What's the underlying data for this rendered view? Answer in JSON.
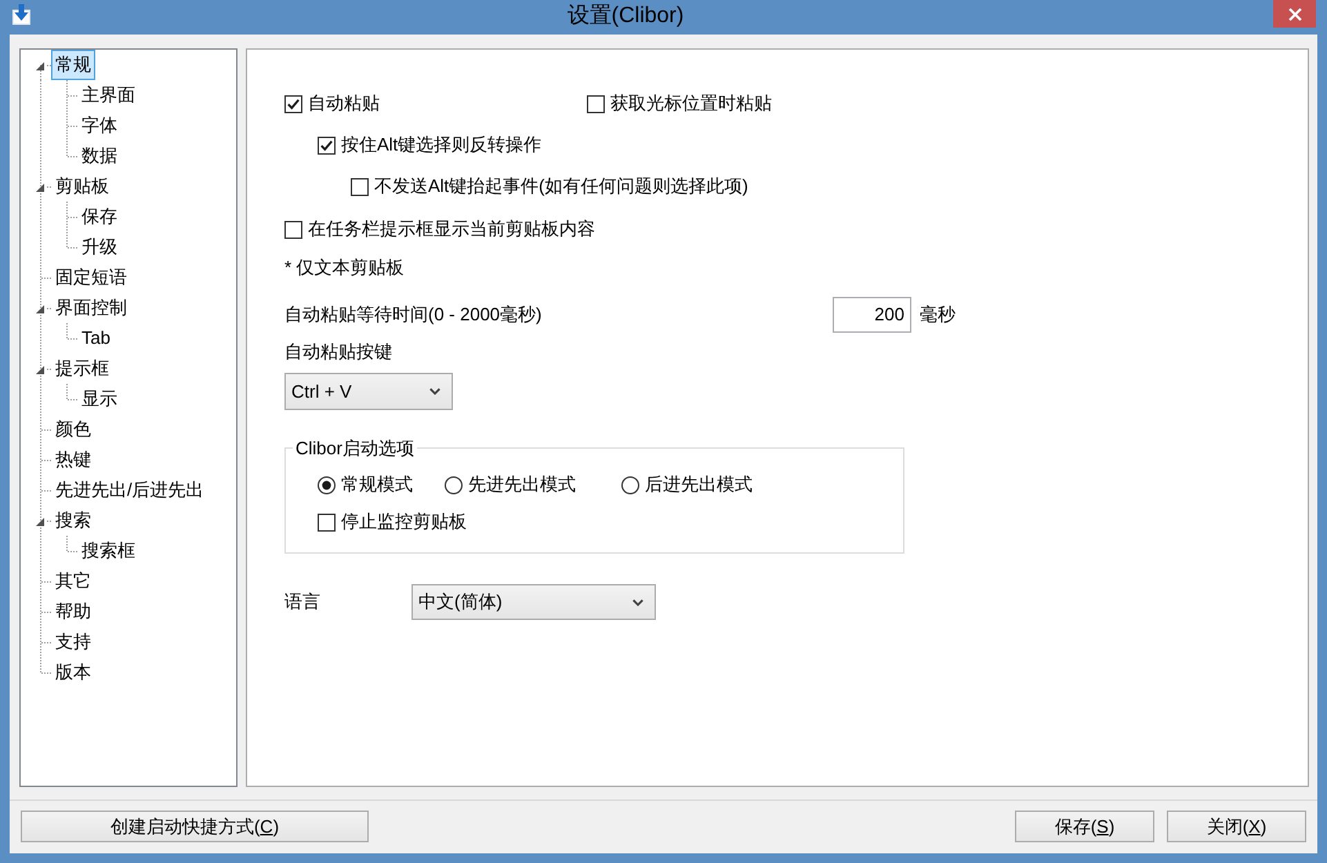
{
  "window": {
    "title": "设置(Clibor)"
  },
  "tree": [
    {
      "label": "常规",
      "selected": true,
      "expanded": true,
      "children": [
        {
          "label": "主界面",
          "selected": false
        },
        {
          "label": "字体",
          "selected": false
        },
        {
          "label": "数据",
          "selected": false
        }
      ]
    },
    {
      "label": "剪贴板",
      "selected": false,
      "expanded": true,
      "children": [
        {
          "label": "保存",
          "selected": false
        },
        {
          "label": "升级",
          "selected": false
        }
      ]
    },
    {
      "label": "固定短语",
      "selected": false
    },
    {
      "label": "界面控制",
      "selected": false,
      "expanded": true,
      "children": [
        {
          "label": "Tab",
          "selected": false
        }
      ]
    },
    {
      "label": "提示框",
      "selected": false,
      "expanded": true,
      "children": [
        {
          "label": "显示",
          "selected": false
        }
      ]
    },
    {
      "label": "颜色",
      "selected": false
    },
    {
      "label": "热键",
      "selected": false
    },
    {
      "label": "先进先出/后进先出",
      "selected": false
    },
    {
      "label": "搜索",
      "selected": false,
      "expanded": true,
      "children": [
        {
          "label": "搜索框",
          "selected": false
        }
      ]
    },
    {
      "label": "其它",
      "selected": false
    },
    {
      "label": "帮助",
      "selected": false
    },
    {
      "label": "支持",
      "selected": false
    },
    {
      "label": "版本",
      "selected": false
    }
  ],
  "general": {
    "auto_paste": {
      "label": "自动粘贴",
      "checked": true
    },
    "paste_at_cursor": {
      "label": "获取光标位置时粘贴",
      "checked": false
    },
    "alt_invert": {
      "label": "按住Alt键选择则反转操作",
      "checked": true
    },
    "no_alt_keyup": {
      "label": "不发送Alt键抬起事件(如有任何问题则选择此项)",
      "checked": false
    },
    "taskbar_tooltip": {
      "label": "在任务栏提示框显示当前剪贴板内容",
      "checked": false
    },
    "note": "* 仅文本剪贴板",
    "wait_time": {
      "label": "自动粘贴等待时间(0 - 2000毫秒)",
      "value": "200",
      "unit": "毫秒"
    },
    "paste_key": {
      "label": "自动粘贴按键",
      "value": "Ctrl + V"
    },
    "startup_group": {
      "title": "Clibor启动选项",
      "modes": [
        {
          "label": "常规模式",
          "selected": true
        },
        {
          "label": "先进先出模式",
          "selected": false
        },
        {
          "label": "后进先出模式",
          "selected": false
        }
      ],
      "stop_monitoring": {
        "label": "停止监控剪贴板",
        "checked": false
      }
    },
    "language": {
      "label": "语言",
      "value": "中文(简体)"
    }
  },
  "footer": {
    "left_buttons": [
      {
        "label": "创建启动快捷方式(C)",
        "underlined_mnemonic": true
      }
    ],
    "right_buttons": [
      {
        "label": "保存(S)",
        "underlined_mnemonic": true
      },
      {
        "label": "关闭(X)",
        "underlined_mnemonic": true
      }
    ]
  }
}
